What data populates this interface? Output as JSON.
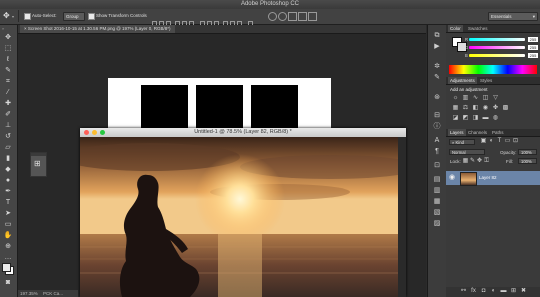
{
  "app": {
    "title": "Adobe Photoshop CC"
  },
  "options": {
    "auto_select_label": "Auto-Select:",
    "group_value": "Group",
    "transform_label": "Show Transform Controls",
    "workspace": "Essentials"
  },
  "document": {
    "tab_label": "Screen Shot 2016-10-15 at 1.30.56 PM.png @ 197% (Layer 0, RGB/8*)",
    "window_title": "Untitled-1 @ 78.5% (Layer 82, RGB/8) *"
  },
  "status": {
    "zoom": "197.35%",
    "info": "PCK Ca..."
  },
  "panels": {
    "color": {
      "tabs": [
        "Color",
        "Swatches"
      ],
      "channels": [
        {
          "name": "R",
          "value": "255",
          "color": "#e04040"
        },
        {
          "name": "G",
          "value": "255",
          "color": "#40c040"
        },
        {
          "name": "B",
          "value": "255",
          "color": "#4060e0"
        }
      ]
    },
    "adjustments": {
      "tabs": [
        "Adjustments",
        "Styles"
      ],
      "heading": "Add an adjustment",
      "icons": [
        "brightness-icon",
        "levels-icon",
        "curves-icon",
        "exposure-icon",
        "vibrance-icon",
        "hue-icon",
        "color-balance-icon",
        "bw-icon",
        "photo-filter-icon",
        "channel-mixer-icon",
        "lookup-icon",
        "invert-icon",
        "posterize-icon",
        "threshold-icon",
        "gradient-map-icon",
        "selective-color-icon"
      ]
    },
    "layers": {
      "tabs": [
        "Layers",
        "Channels",
        "Paths"
      ],
      "kind": "Kind",
      "blend_mode": "Normal",
      "opacity_label": "Opacity:",
      "opacity_value": "100%",
      "lock_label": "Lock:",
      "fill_label": "Fill:",
      "fill_value": "100%",
      "layer_name": "Layer 82"
    }
  },
  "colors": {
    "app_bg": "#2b2b2b",
    "panel_bg": "#3a3a3a",
    "selected_layer": "#6b85a8"
  }
}
